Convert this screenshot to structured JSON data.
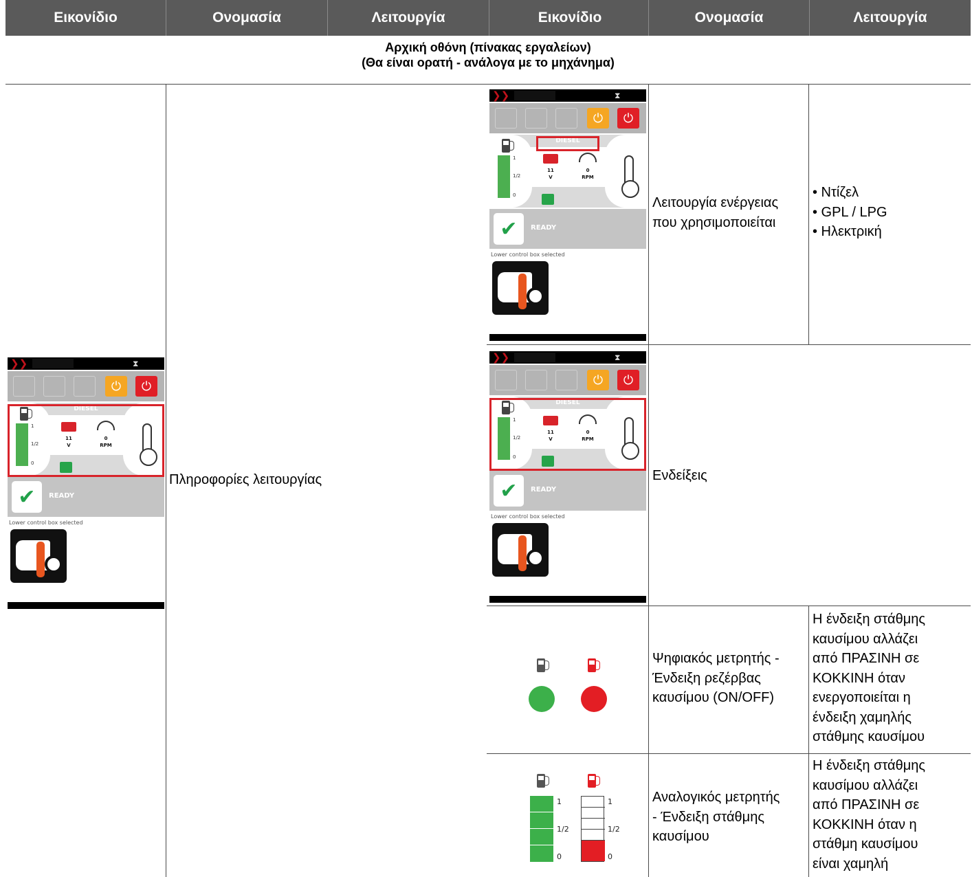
{
  "header": {
    "col1": "Εικονίδιο",
    "col2": "Ονομασία",
    "col3": "Λειτουργία",
    "col4": "Εικονίδιο",
    "col5": "Ονομασία",
    "col6": "Λειτουργία"
  },
  "section": {
    "line1": "Αρχική οθόνη (πίνακας εργαλείων)",
    "line2": "(Θα είναι ορατή - ανάλογα με το μηχάνημα)"
  },
  "screen": {
    "fuel_type": "DIESEL",
    "gauge_full": "1",
    "gauge_half": "1/2",
    "gauge_empty": "0",
    "voltage_value": "11",
    "voltage_unit": "V",
    "rpm_value": "0",
    "rpm_unit": "RPM",
    "ready": "READY",
    "lower_control": "Lower control box selected"
  },
  "left": {
    "name": "Πληροφορίες λειτουργίας"
  },
  "rows": [
    {
      "name_lines": [
        "Λειτουργία ενέργειας",
        "που χρησιμοποιείται"
      ],
      "func_lines": [
        "• Ντίζελ",
        "• GPL / LPG",
        "• Ηλεκτρική"
      ]
    },
    {
      "name_lines": [
        "Ενδείξεις"
      ],
      "func_lines": []
    },
    {
      "name_lines": [
        "Ψηφιακός μετρητής -",
        "Ένδειξη ρεζέρβας",
        "καυσίμου (ON/OFF)"
      ],
      "func_lines": [
        "Η ένδειξη στάθμης",
        "καυσίμου αλλάζει",
        "από ΠΡΑΣΙΝΗ σε",
        "ΚΟΚΚΙΝΗ όταν",
        "ενεργοποιείται η",
        "ένδειξη χαμηλής",
        "στάθμης καυσίμου"
      ]
    },
    {
      "name_lines": [
        "Αναλογικός μετρητής",
        "- Ένδειξη στάθμης",
        "καυσίμου"
      ],
      "func_lines": [
        "Η ένδειξη στάθμης",
        "καυσίμου αλλάζει",
        "από ΠΡΑΣΙΝΗ σε",
        "ΚΟΚΚΙΝΗ όταν η",
        "στάθμη καυσίμου",
        "είναι χαμηλή"
      ]
    }
  ],
  "analog": {
    "full": "1",
    "half": "1/2",
    "empty": "0"
  },
  "colors": {
    "header_bg": "#5a5a5a",
    "green": "#3cb04a",
    "red": "#e31e24",
    "border": "#4a4a4a"
  },
  "icons": [
    "fuel-pump-icon",
    "battery-icon",
    "rpm-gauge-icon",
    "thermometer-icon",
    "check-icon",
    "warning-icon",
    "power-icon"
  ]
}
